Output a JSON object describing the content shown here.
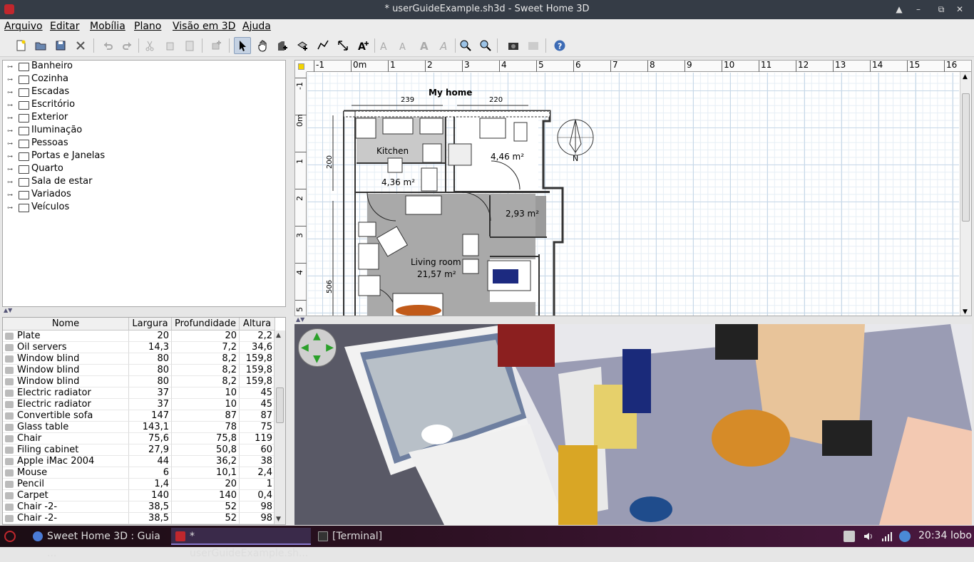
{
  "window": {
    "title": "* userGuideExample.sh3d - Sweet Home 3D"
  },
  "menu": [
    "Arquivo",
    "Editar",
    "Mobília",
    "Plano",
    "Visão em 3D",
    "Ajuda"
  ],
  "toolbar_icons": [
    "new-file-icon",
    "open-icon",
    "save-icon",
    "preferences-icon",
    "undo-icon",
    "redo-icon",
    "cut-icon",
    "copy-icon",
    "paste-icon",
    "add-furniture-icon",
    "select-mode-icon",
    "pan-mode-icon",
    "create-walls-icon",
    "create-rooms-icon",
    "create-polylines-icon",
    "create-dimensions-icon",
    "add-text-icon",
    "text-style-icon",
    "increase-text-icon",
    "decrease-text-icon",
    "italic-text-icon",
    "zoom-in-icon",
    "zoom-out-icon",
    "create-photo-icon",
    "create-video-icon",
    "help-icon"
  ],
  "catalog": [
    {
      "label": "Banheiro"
    },
    {
      "label": "Cozinha"
    },
    {
      "label": "Escadas"
    },
    {
      "label": "Escritório"
    },
    {
      "label": "Exterior"
    },
    {
      "label": "Iluminação"
    },
    {
      "label": "Pessoas"
    },
    {
      "label": "Portas e Janelas"
    },
    {
      "label": "Quarto"
    },
    {
      "label": "Sala de estar"
    },
    {
      "label": "Variados"
    },
    {
      "label": "Veículos"
    }
  ],
  "furniture_table": {
    "headers": [
      "Nome",
      "Largura",
      "Profundidade",
      "Altura"
    ],
    "rows": [
      [
        "Plate",
        "20",
        "20",
        "2,2"
      ],
      [
        "Oil servers",
        "14,3",
        "7,2",
        "34,6"
      ],
      [
        "Window blind",
        "80",
        "8,2",
        "159,8"
      ],
      [
        "Window blind",
        "80",
        "8,2",
        "159,8"
      ],
      [
        "Window blind",
        "80",
        "8,2",
        "159,8"
      ],
      [
        "Electric radiator",
        "37",
        "10",
        "45"
      ],
      [
        "Electric radiator",
        "37",
        "10",
        "45"
      ],
      [
        "Convertible sofa",
        "147",
        "87",
        "87"
      ],
      [
        "Glass table",
        "143,1",
        "78",
        "75"
      ],
      [
        "Chair",
        "75,6",
        "75,8",
        "119"
      ],
      [
        "Filing cabinet",
        "27,9",
        "50,8",
        "60"
      ],
      [
        "Apple iMac 2004",
        "44",
        "36,2",
        "38"
      ],
      [
        "Mouse",
        "6",
        "10,1",
        "2,4"
      ],
      [
        "Pencil",
        "1,4",
        "20",
        "1"
      ],
      [
        "Carpet",
        "140",
        "140",
        "0,4"
      ],
      [
        "Chair -2-",
        "38,5",
        "52",
        "98"
      ],
      [
        "Chair -2-",
        "38,5",
        "52",
        "98"
      ]
    ]
  },
  "plan": {
    "ruler_top": [
      "-1",
      "0m",
      "1",
      "2",
      "3",
      "4",
      "5",
      "6",
      "7",
      "8",
      "9",
      "10",
      "11",
      "12",
      "13",
      "14",
      "15",
      "16"
    ],
    "ruler_left": [
      "-1",
      "0m",
      "1",
      "2",
      "3",
      "4",
      "5"
    ],
    "title": "My home",
    "dims": [
      "239",
      "220",
      "200",
      "506"
    ],
    "rooms": [
      {
        "name": "Kitchen",
        "area": "4,36 m²"
      },
      {
        "name": "",
        "area": "4,46 m²"
      },
      {
        "name": "",
        "area": "2,93 m²"
      },
      {
        "name": "Living room",
        "area": "21,57 m²"
      }
    ],
    "compass_label": "N"
  },
  "taskbar": {
    "tasks": [
      "Sweet Home 3D : Guia ...",
      "* userGuideExample.sh...",
      "[Terminal]"
    ],
    "clock": "20:34",
    "user": "lobo"
  }
}
